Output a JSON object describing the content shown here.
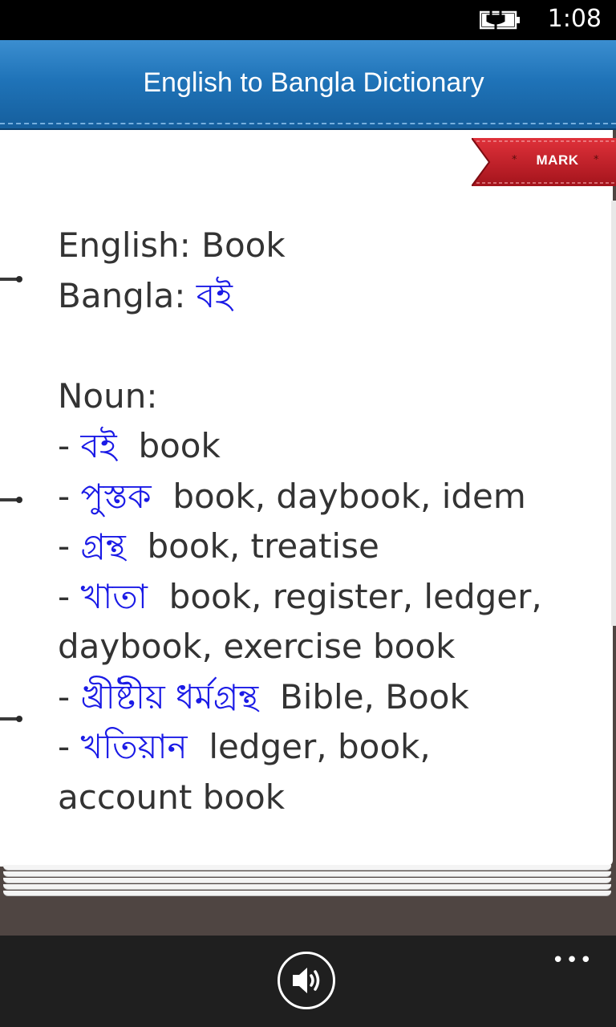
{
  "status_bar": {
    "battery_icon": "battery-charging-icon",
    "time": "1:08"
  },
  "header": {
    "title": "English to Bangla Dictionary"
  },
  "mark_ribbon": {
    "label": "MARK",
    "star_left": "*",
    "star_right": "*"
  },
  "entry": {
    "english_label": "English: ",
    "english_word": "Book",
    "bangla_label": "Bangla: ",
    "bangla_word": "বই",
    "pos": "Noun:",
    "meanings": [
      {
        "dash": "- ",
        "bangla": "বই",
        "english": "  book"
      },
      {
        "dash": "- ",
        "bangla": "পুস্তক",
        "english": "  book, daybook, idem"
      },
      {
        "dash": "- ",
        "bangla": "গ্রন্থ",
        "english": "  book, treatise"
      },
      {
        "dash": "- ",
        "bangla": "খাতা",
        "english": "  book, register, ledger,",
        "continuation": "daybook, exercise book"
      },
      {
        "dash": "- ",
        "bangla": "খ্রীষ্টীয় ধর্মগ্রন্থ",
        "english": "  Bible, Book"
      },
      {
        "dash": "- ",
        "bangla": "খতিয়ান",
        "english": "  ledger, book,",
        "continuation": "account book"
      }
    ]
  },
  "app_bar": {
    "speaker_icon": "speaker-icon",
    "more_label": "•••"
  },
  "colors": {
    "header_blue": "#1f73b8",
    "bangla_text": "#1a1ae6",
    "ribbon_red": "#c8202a"
  }
}
